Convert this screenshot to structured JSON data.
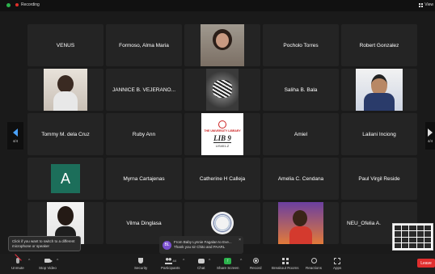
{
  "topbar": {
    "recording_label": "Recording",
    "view_label": "View"
  },
  "tiles": [
    {
      "name": "VENUS"
    },
    {
      "name": "Formoso, Alma Maria"
    },
    {
      "name": ""
    },
    {
      "name": "Pocholo Torres"
    },
    {
      "name": "Robert Gonzalez"
    },
    {
      "name": ""
    },
    {
      "name": "JANNICE B. VEJERANO..."
    },
    {
      "name": ""
    },
    {
      "name": "Saliha B. Bala"
    },
    {
      "name": ""
    },
    {
      "name": "Tommy M. dela Cruz"
    },
    {
      "name": "Ruby Ann"
    },
    {
      "name": ""
    },
    {
      "name": "Amiel"
    },
    {
      "name": "Lailani Inciong"
    },
    {
      "name": "",
      "avatar_letter": "A"
    },
    {
      "name": "Myrna Cartajenas"
    },
    {
      "name": "Catherine H Calleja"
    },
    {
      "name": "Amelia C. Cendana"
    },
    {
      "name": "Paul Virgil Reside"
    },
    {
      "name": ""
    },
    {
      "name": "Vilma Dinglasa"
    },
    {
      "name": ""
    },
    {
      "name": ""
    },
    {
      "name": "NEU_Ofelia A."
    }
  ],
  "library_card": {
    "org": "THE UNIVERSITY LIBRARY",
    "title": "LIB 9",
    "room": "LIS401-Z"
  },
  "pager": {
    "left_label": "4/4",
    "right_label": "4/4"
  },
  "tooltip": {
    "text": "Click if you want to switch to a different microphone or speaker"
  },
  "chat_notification": {
    "initials": "BL",
    "line1": "From Baby Lynnie Fagalan to Eve...",
    "line2": "Thank you sir Chito and PAARL",
    "close": "×"
  },
  "toolbar": {
    "unmute": "Unmute",
    "stop_video": "Stop Video",
    "security": "Security",
    "participants": "Participants",
    "participants_count": "44",
    "chat": "Chat",
    "share_screen": "Share Screen",
    "record": "Record",
    "breakout_rooms": "Breakout Rooms",
    "reactions": "Reactions",
    "apps": "Apps",
    "leave": "Leave"
  },
  "colors": {
    "share_green": "#2bb24c",
    "leave_red": "#e02e2e",
    "pager_blue": "#4aa3ff",
    "avatar_green": "#1c6e5a"
  }
}
